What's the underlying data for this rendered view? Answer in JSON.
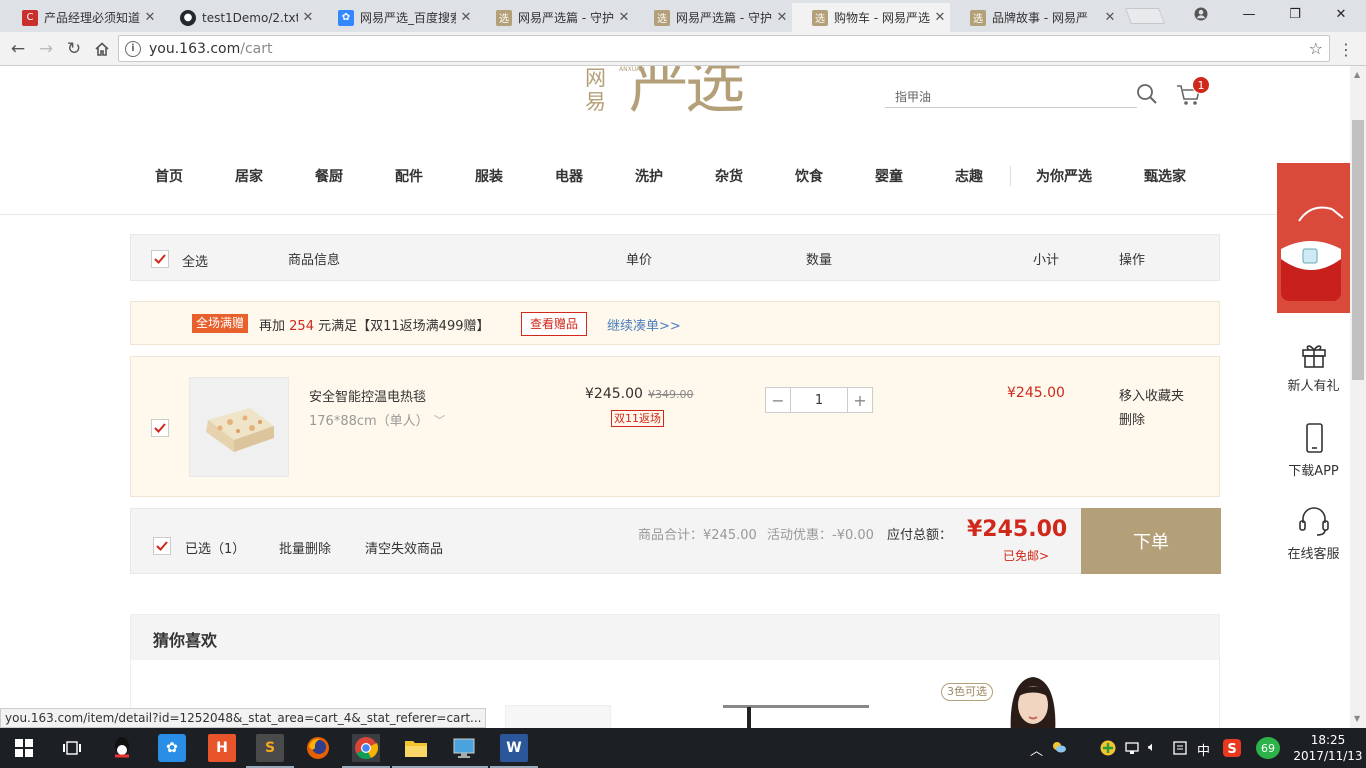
{
  "browser": {
    "tabs": [
      {
        "title": "产品经理必须知道",
        "icon": "csdn-icon",
        "color": "#c9302c"
      },
      {
        "title": "test1Demo/2.txt",
        "icon": "github-icon",
        "color": "#24292e"
      },
      {
        "title": "网易严选_百度搜索",
        "icon": "baidu-icon",
        "color": "#3388ff"
      },
      {
        "title": "网易严选篇 - 守护",
        "icon": "yanxuan-icon",
        "color": "#b4a078"
      },
      {
        "title": "网易严选篇 - 守护",
        "icon": "yanxuan-icon",
        "color": "#b4a078"
      },
      {
        "title": "购物车 - 网易严选",
        "icon": "yanxuan-icon",
        "color": "#b4a078"
      },
      {
        "title": "品牌故事 - 网易严",
        "icon": "yanxuan-icon",
        "color": "#b4a078"
      }
    ],
    "active_tab": 5,
    "tab_favicon_char": "选",
    "url_host": "you.163.com",
    "url_path": "/cart",
    "status_url": "you.163.com/item/detail?id=1252048&_stat_area=cart_4&_stat_referer=cart..."
  },
  "header": {
    "logo_wangyi": "网易",
    "logo_yanxuan": "严选",
    "logo_pinyin": "ANXUAN",
    "search_placeholder": "指甲油",
    "cart_count": "1",
    "nav": [
      "首页",
      "居家",
      "餐厨",
      "配件",
      "服装",
      "电器",
      "洗护",
      "杂货",
      "饮食",
      "婴童",
      "志趣",
      "为你严选",
      "甄选家"
    ]
  },
  "cart_header": {
    "select_all": "全选",
    "product_info": "商品信息",
    "unit_price": "单价",
    "quantity": "数量",
    "subtotal": "小计",
    "action": "操作"
  },
  "promo": {
    "tag": "全场满赠",
    "text_before": "再加",
    "amount": "254",
    "text_after": "元满足【双11返场满499赠】",
    "gift_button": "查看赠品",
    "more_link": "继续凑单>>"
  },
  "item": {
    "name": "安全智能控温电热毯",
    "spec": "176*88cm（单人）",
    "price": "¥245.00",
    "original_price": "¥349.00",
    "tag": "双11返场",
    "quantity": "1",
    "subtotal": "¥245.00",
    "move_to_fav": "移入收藏夹",
    "delete": "删除"
  },
  "summary": {
    "selected": "已选（1）",
    "batch_delete": "批量删除",
    "clear_invalid": "清空失效商品",
    "goods_total": "商品合计：¥245.00",
    "discount": "活动优惠：-¥0.00",
    "payable_label": "应付总额：",
    "payable": "¥245.00",
    "free_shipping": "已免邮>",
    "checkout": "下单"
  },
  "guess": {
    "title": "猜你喜欢",
    "color_tag": "3色可选"
  },
  "side": {
    "new_user": "新人有礼",
    "download_app": "下载APP",
    "customer_service": "在线客服"
  },
  "taskbar": {
    "time": "18:25",
    "date": "2017/11/13",
    "ime": "中",
    "battery": "69"
  },
  "colors": {
    "brand_gold": "#b4a078",
    "price_red": "#d0281a",
    "promo_bg": "#fff8ec"
  }
}
